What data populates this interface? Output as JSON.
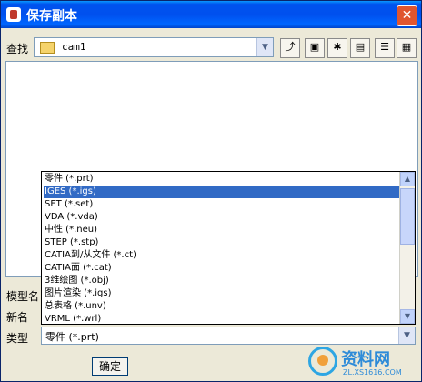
{
  "window": {
    "title": "保存副本"
  },
  "look_in": {
    "label": "查找",
    "value": "cam1"
  },
  "toolbar": {
    "up_folder": "up-folder-icon",
    "go_to_working": "working-dir-icon",
    "new_folder": "new-folder-icon",
    "recent": "recent-folder-icon",
    "list_view": "list-view-icon",
    "details_view": "details-view-icon"
  },
  "fields": {
    "model_name_label": "模型名",
    "new_name_label": "新名",
    "type_label": "类型",
    "type_value": "零件 (*.prt)"
  },
  "type_options": [
    "零件 (*.prt)",
    "IGES (*.igs)",
    "SET (*.set)",
    "VDA (*.vda)",
    "中性 (*.neu)",
    "STEP (*.stp)",
    "CATIA到/从文件 (*.ct)",
    "CATIA面 (*.cat)",
    "3维绘图 (*.obj)",
    "图片渲染 (*.igs)",
    "总表格 (*.unv)",
    "VRML (*.wrl)"
  ],
  "selected_option_index": 1,
  "buttons": {
    "ok": "确定"
  },
  "watermark": {
    "brand": "资料网",
    "url": "ZL.XS1616.COM"
  }
}
